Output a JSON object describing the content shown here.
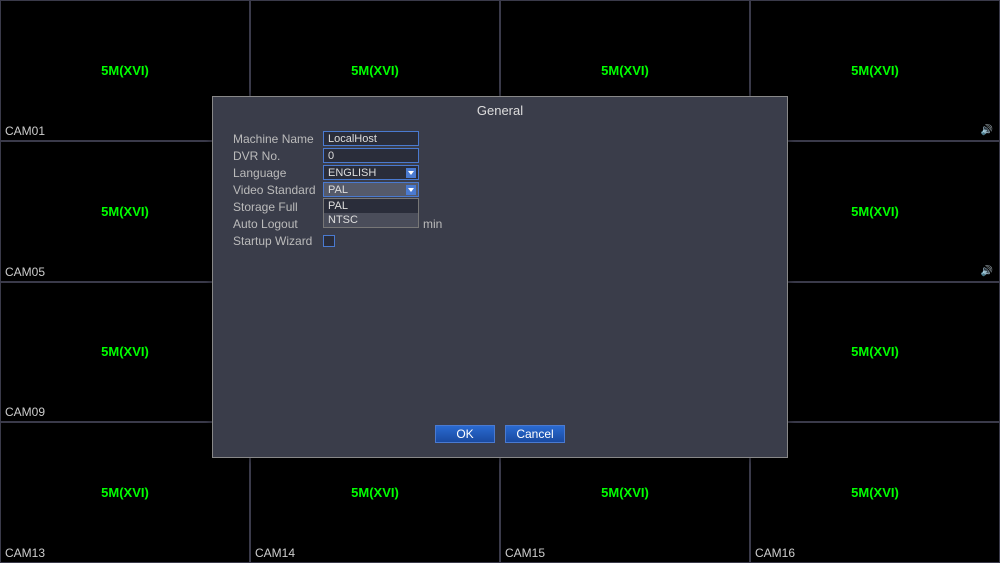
{
  "grid": {
    "cell_label": "5M(XVI)",
    "cameras": [
      "CAM01",
      "",
      "",
      "",
      "CAM05",
      "",
      "",
      "",
      "CAM09",
      "",
      "",
      "",
      "CAM13",
      "CAM14",
      "CAM15",
      "CAM16"
    ]
  },
  "dialog": {
    "title": "General",
    "labels": {
      "machine_name": "Machine Name",
      "dvr_no": "DVR No.",
      "language": "Language",
      "video_standard": "Video Standard",
      "storage_full": "Storage Full",
      "auto_logout": "Auto Logout",
      "startup_wizard": "Startup Wizard"
    },
    "values": {
      "machine_name": "LocalHost",
      "dvr_no": "0",
      "language": "ENGLISH",
      "video_standard": "PAL",
      "auto_logout_unit": "min"
    },
    "video_standard_options": [
      "PAL",
      "NTSC"
    ],
    "buttons": {
      "ok": "OK",
      "cancel": "Cancel"
    }
  }
}
